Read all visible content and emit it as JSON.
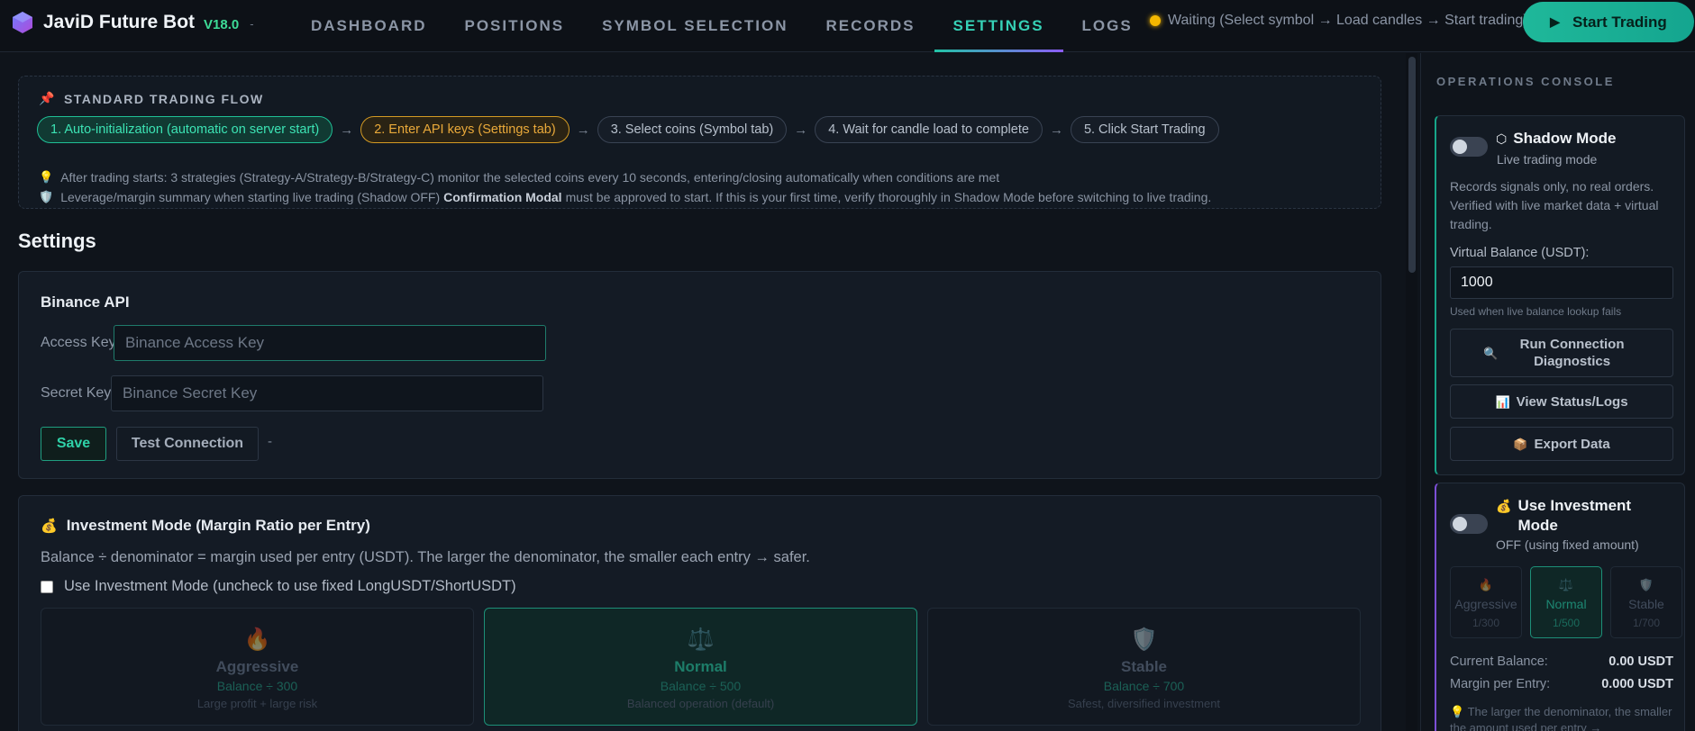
{
  "header": {
    "app_name": "JaviD Future Bot",
    "version": "V18.0",
    "version_suffix": "-",
    "nav": [
      "DASHBOARD",
      "POSITIONS",
      "SYMBOL SELECTION",
      "RECORDS",
      "SETTINGS",
      "LOGS"
    ],
    "active_tab": "SETTINGS",
    "status_text": "Waiting (Select symbol → Load candles → Start trading)",
    "start_button": "Start Trading"
  },
  "flow": {
    "title": "STANDARD TRADING FLOW",
    "steps": [
      "1. Auto-initialization (automatic on server start)",
      "2. Enter API keys (Settings tab)",
      "3. Select coins (Symbol tab)",
      "4. Wait for candle load to complete",
      "5. Click Start Trading"
    ],
    "arrow": "→",
    "note1": "After trading starts: 3 strategies (Strategy-A/Strategy-B/Strategy-C) monitor the selected coins every 10 seconds, entering/closing automatically when conditions are met",
    "note2_pre": "Leverage/margin summary when starting live trading (Shadow OFF)",
    "note2_bold": "Confirmation Modal",
    "note2_post": "must be approved to start. If this is your first time, verify thoroughly in Shadow Mode before switching to live trading."
  },
  "settings": {
    "page_title": "Settings",
    "api": {
      "title": "Binance API",
      "access_label": "Access Key",
      "access_placeholder": "Binance Access Key",
      "secret_label": "Secret Key",
      "secret_placeholder": "Binance Secret Key",
      "save": "Save",
      "test": "Test Connection",
      "status": "-"
    },
    "investment": {
      "title": "Investment Mode (Margin Ratio per Entry)",
      "description": "Balance ÷ denominator = margin used per entry (USDT). The larger the denominator, the smaller each entry → safer.",
      "checkbox_label": "Use Investment Mode (uncheck to use fixed LongUSDT/ShortUSDT)",
      "modes": [
        {
          "name": "Aggressive",
          "ratio": "Balance ÷ 300",
          "desc": "Large profit + large risk"
        },
        {
          "name": "Normal",
          "ratio": "Balance ÷ 500",
          "desc": "Balanced operation (default)"
        },
        {
          "name": "Stable",
          "ratio": "Balance ÷ 700",
          "desc": "Safest, diversified investment"
        }
      ],
      "active_mode": "Normal"
    }
  },
  "sidebar": {
    "title": "OPERATIONS CONSOLE",
    "shadow": {
      "title": "Shadow Mode",
      "subtitle": "Live trading mode",
      "description": "Records signals only, no real orders. Verified with live market data + virtual trading.",
      "balance_label": "Virtual Balance (USDT):",
      "balance_value": "1000",
      "balance_hint": "Used when live balance lookup fails",
      "diag_button": "Run Connection Diagnostics",
      "logs_button": "View Status/Logs",
      "export_button": "Export Data"
    },
    "investment": {
      "title": "Use Investment Mode",
      "subtitle": "OFF (using fixed amount)",
      "modes": [
        {
          "name": "Aggressive",
          "ratio": "1/300"
        },
        {
          "name": "Normal",
          "ratio": "1/500"
        },
        {
          "name": "Stable",
          "ratio": "1/700"
        }
      ],
      "current_balance_label": "Current Balance:",
      "current_balance_value": "0.00 USDT",
      "margin_label": "Margin per Entry:",
      "margin_value": "0.000 USDT",
      "note": "The larger the denominator, the smaller the amount used per entry →"
    }
  },
  "colors": {
    "accent": "#36d1b6",
    "start_button": "#1fb89a",
    "status_waiting": "#f5b800",
    "investment_border": "#7c4fd6"
  },
  "icons": {
    "brand": "hexagon-cube-icon",
    "flow": "pin-icon",
    "note1": "lightbulb-icon",
    "note2": "shield-icon",
    "investment": "money-bag-icon",
    "aggressive": "flame-icon",
    "normal": "scales-icon",
    "stable": "shield-icon",
    "shadow": "hexagon-icon",
    "diag": "magnifier-icon",
    "logs": "bar-chart-icon",
    "export": "package-icon",
    "play": "play-icon"
  }
}
